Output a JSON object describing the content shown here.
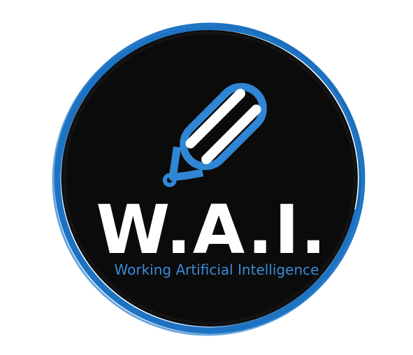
{
  "logo": {
    "wordmark": "W.A.I.",
    "tagline": "Working Artificial Intelligence",
    "icon": "pencil-icon",
    "colors": {
      "background": "#ffffff",
      "disc": "#0b0b0b",
      "ring": "#1d73c2",
      "accent": "#2f86d4",
      "wordmark": "#ffffff"
    }
  }
}
